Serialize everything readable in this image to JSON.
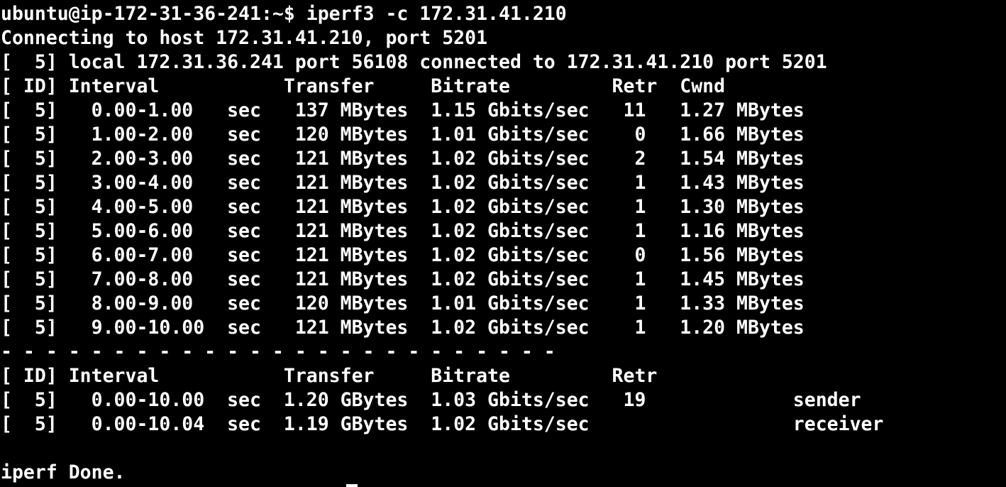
{
  "colors": {
    "background": "#000000",
    "foreground": "#ffffff"
  },
  "terminal": {
    "lines": [
      "ubuntu@ip-172-31-36-241:~$ iperf3 -c 172.31.41.210",
      "Connecting to host 172.31.41.210, port 5201",
      "[  5] local 172.31.36.241 port 56108 connected to 172.31.41.210 port 5201",
      "[ ID] Interval           Transfer     Bitrate         Retr  Cwnd",
      "[  5]   0.00-1.00   sec   137 MBytes  1.15 Gbits/sec   11   1.27 MBytes",
      "[  5]   1.00-2.00   sec   120 MBytes  1.01 Gbits/sec    0   1.66 MBytes",
      "[  5]   2.00-3.00   sec   121 MBytes  1.02 Gbits/sec    2   1.54 MBytes",
      "[  5]   3.00-4.00   sec   121 MBytes  1.02 Gbits/sec    1   1.43 MBytes",
      "[  5]   4.00-5.00   sec   121 MBytes  1.02 Gbits/sec    1   1.30 MBytes",
      "[  5]   5.00-6.00   sec   121 MBytes  1.02 Gbits/sec    1   1.16 MBytes",
      "[  5]   6.00-7.00   sec   121 MBytes  1.02 Gbits/sec    0   1.56 MBytes",
      "[  5]   7.00-8.00   sec   121 MBytes  1.02 Gbits/sec    1   1.45 MBytes",
      "[  5]   8.00-9.00   sec   120 MBytes  1.01 Gbits/sec    1   1.33 MBytes",
      "[  5]   9.00-10.00  sec   121 MBytes  1.02 Gbits/sec    1   1.20 MBytes",
      "- - - - - - - - - - - - - - - - - - - - - - - - -",
      "[ ID] Interval           Transfer     Bitrate         Retr",
      "[  5]   0.00-10.00  sec  1.20 GBytes  1.03 Gbits/sec   19             sender",
      "[  5]   0.00-10.04  sec  1.19 GBytes  1.02 Gbits/sec                  receiver",
      "",
      "iperf Done."
    ]
  }
}
